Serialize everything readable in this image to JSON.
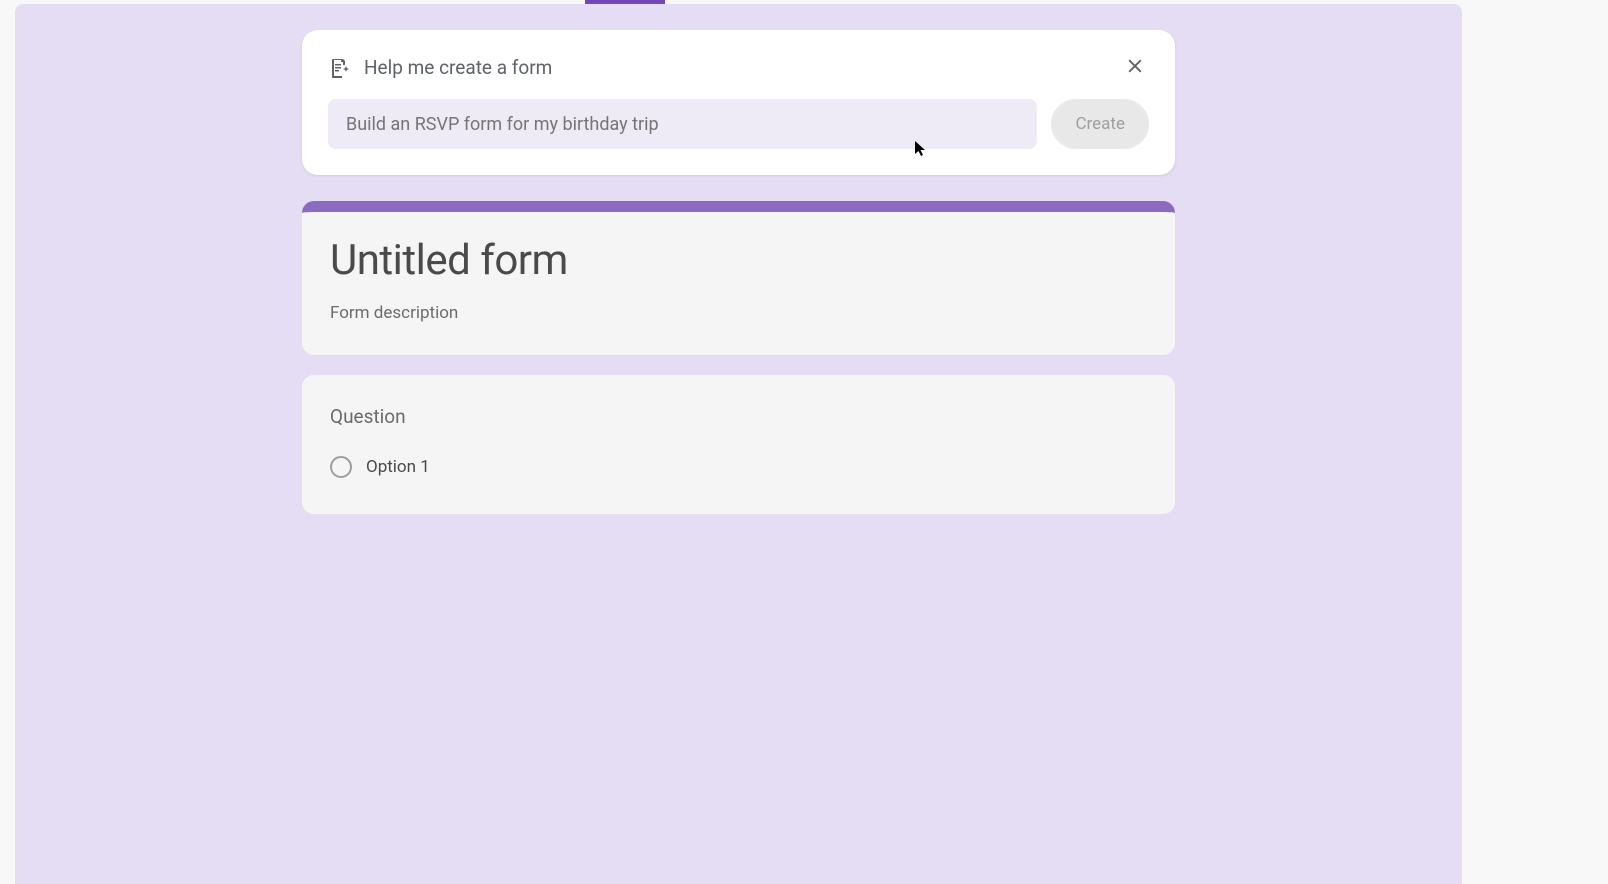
{
  "aiCard": {
    "title": "Help me create a form",
    "inputPlaceholder": "Build an RSVP form for my birthday trip",
    "createLabel": "Create"
  },
  "formHeader": {
    "title": "Untitled form",
    "description": "Form description"
  },
  "question": {
    "label": "Question",
    "options": [
      {
        "label": "Option 1"
      }
    ]
  }
}
